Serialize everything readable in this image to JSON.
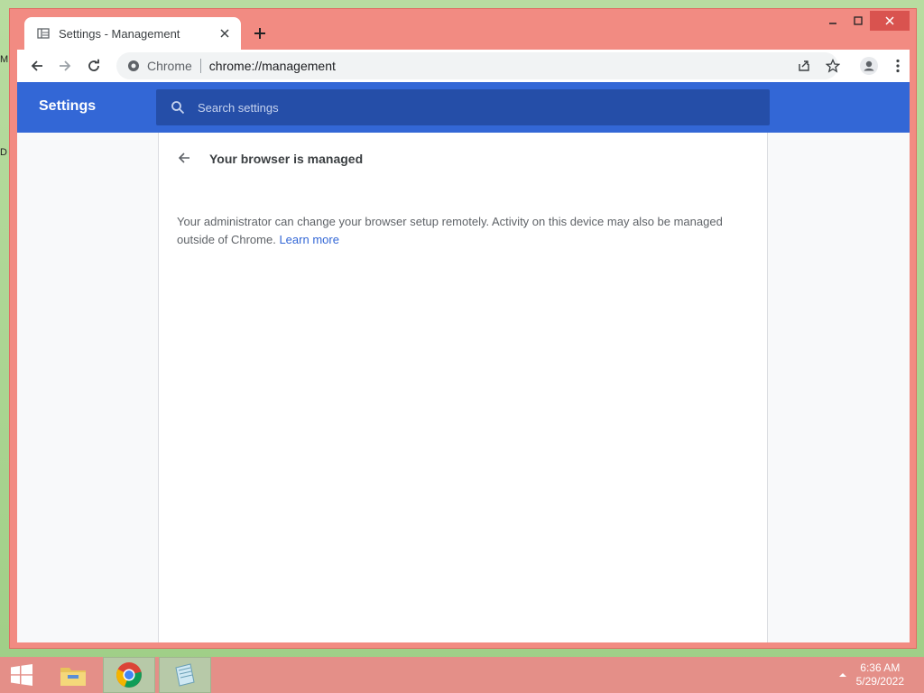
{
  "desktop": {
    "icon_labels": [
      "M",
      "D"
    ]
  },
  "tab": {
    "title": "Settings - Management"
  },
  "toolbar": {
    "site_chip": "Chrome",
    "url": "chrome://management"
  },
  "settings": {
    "brand": "Settings",
    "search_placeholder": "Search settings",
    "heading": "Your browser is managed",
    "body_text": "Your administrator can change your browser setup remotely. Activity on this device may also be managed outside of Chrome. ",
    "learn_more": "Learn more"
  },
  "taskbar": {
    "time": "6:36 AM",
    "date": "5/29/2022"
  },
  "colors": {
    "accent": "#3367d6",
    "window_frame": "#f28b82",
    "link": "#3367d6"
  }
}
